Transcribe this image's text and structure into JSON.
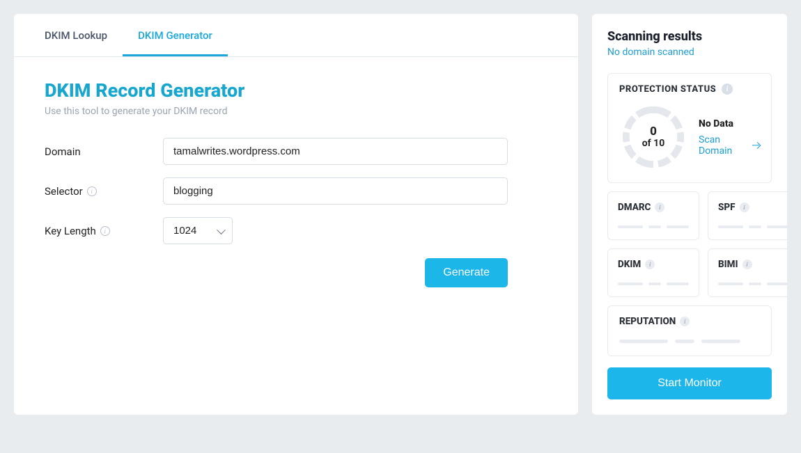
{
  "tabs": {
    "lookup": "DKIM Lookup",
    "generator": "DKIM Generator"
  },
  "main": {
    "title": "DKIM Record Generator",
    "subtitle": "Use this tool to generate your DKIM record",
    "labels": {
      "domain": "Domain",
      "selector": "Selector",
      "key_length": "Key Length"
    },
    "form": {
      "domain": "tamalwrites.wordpress.com",
      "selector": "blogging",
      "key_length": "1024"
    },
    "generate_label": "Generate"
  },
  "sidebar": {
    "title": "Scanning results",
    "subtitle": "No domain scanned",
    "protection_status": {
      "heading": "PROTECTION STATUS",
      "score": "0",
      "total": "of 10",
      "no_data": "No Data",
      "scan_link": "Scan Domain"
    },
    "mini": {
      "dmarc": "DMARC",
      "spf": "SPF",
      "dkim": "DKIM",
      "bimi": "BIMI"
    },
    "reputation": "REPUTATION",
    "start_monitor": "Start Monitor"
  }
}
